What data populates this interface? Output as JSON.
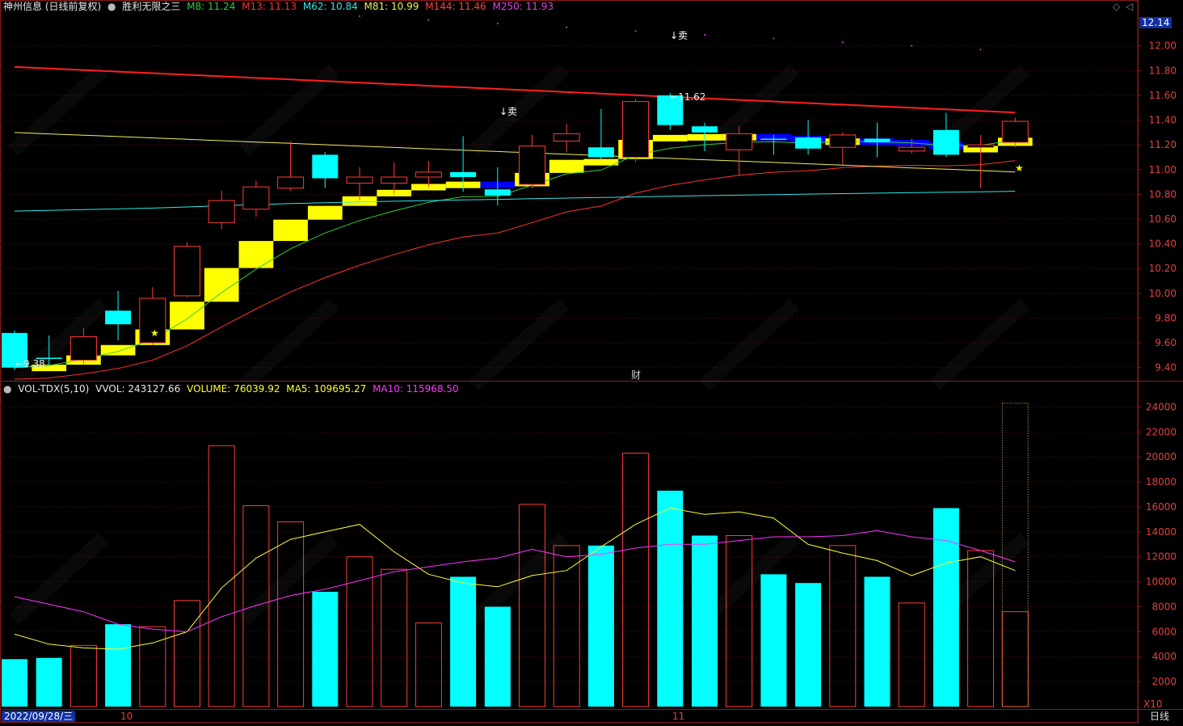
{
  "header": {
    "stock_name": "神州信息 (日线前复权)",
    "indicator_name": "胜利无限之三",
    "ma_labels": [
      {
        "text": "M8: 11.24",
        "color": "#2ecc40"
      },
      {
        "text": "M13: 11.13",
        "color": "#ff3030"
      },
      {
        "text": "M62: 10.84",
        "color": "#2ee6e6"
      },
      {
        "text": "M81: 10.99",
        "color": "#f0f060"
      },
      {
        "text": "M144: 11.46",
        "color": "#ff4040"
      },
      {
        "text": "M250: 11.93",
        "color": "#e040e0"
      }
    ]
  },
  "volume_header": {
    "name": "VOL-TDX(5,10)",
    "vvol": "VVOL: 243127.66",
    "volume": "VOLUME: 76039.92",
    "ma5": "MA5: 109695.27",
    "ma10": "MA10: 115968.50"
  },
  "price_axis": {
    "current_price": "12.14",
    "ticks": [
      "12.00",
      "11.80",
      "11.60",
      "11.40",
      "11.20",
      "11.00",
      "10.80",
      "10.60",
      "10.40",
      "10.20",
      "10.00",
      "9.80",
      "9.60",
      "9.40"
    ]
  },
  "volume_axis": {
    "ticks": [
      "24000",
      "22000",
      "20000",
      "18000",
      "16000",
      "14000",
      "12000",
      "10000",
      "8000",
      "6000",
      "4000",
      "2000"
    ],
    "unit": "X10"
  },
  "annotations": {
    "low_label": "←9.38",
    "high_label": "←11.62",
    "sell_1": "↓卖",
    "sell_2": "↓卖",
    "finance_marker": "财",
    "star": "★"
  },
  "date_axis": {
    "start_date": "2022/09/28/三",
    "month_10": "10",
    "month_11": "11",
    "period": "日线"
  },
  "colors": {
    "up": "#ff3b3b",
    "down": "#00ffff",
    "ma5": "#ffff33",
    "ma10": "#ff33ff",
    "band_up": "#ffff00",
    "band_down": "#0000ff"
  },
  "chart_data": [
    {
      "type": "candlestick",
      "title": "神州信息 (日线前复权)",
      "candles": [
        {
          "o": 9.68,
          "h": 9.7,
          "l": 9.38,
          "c": 9.4
        },
        {
          "o": 9.48,
          "h": 9.66,
          "l": 9.42,
          "c": 9.47
        },
        {
          "o": 9.46,
          "h": 9.72,
          "l": 9.42,
          "c": 9.65
        },
        {
          "o": 9.86,
          "h": 10.02,
          "l": 9.62,
          "c": 9.75
        },
        {
          "o": 9.6,
          "h": 10.05,
          "l": 9.58,
          "c": 9.96
        },
        {
          "o": 9.98,
          "h": 10.41,
          "l": 9.97,
          "c": 10.38
        },
        {
          "o": 10.57,
          "h": 10.83,
          "l": 10.52,
          "c": 10.75
        },
        {
          "o": 10.68,
          "h": 10.91,
          "l": 10.62,
          "c": 10.86
        },
        {
          "o": 10.85,
          "h": 11.23,
          "l": 10.83,
          "c": 10.94
        },
        {
          "o": 11.12,
          "h": 11.14,
          "l": 10.85,
          "c": 10.93
        },
        {
          "o": 10.89,
          "h": 11.02,
          "l": 10.75,
          "c": 10.94
        },
        {
          "o": 10.89,
          "h": 11.06,
          "l": 10.8,
          "c": 10.94
        },
        {
          "o": 10.94,
          "h": 11.07,
          "l": 10.86,
          "c": 10.98
        },
        {
          "o": 10.98,
          "h": 11.27,
          "l": 10.82,
          "c": 10.94
        },
        {
          "o": 10.84,
          "h": 11.02,
          "l": 10.71,
          "c": 10.79
        },
        {
          "o": 10.88,
          "h": 11.28,
          "l": 10.85,
          "c": 11.19
        },
        {
          "o": 11.23,
          "h": 11.37,
          "l": 11.14,
          "c": 11.29
        },
        {
          "o": 11.18,
          "h": 11.49,
          "l": 11.08,
          "c": 11.1
        },
        {
          "o": 11.1,
          "h": 11.57,
          "l": 11.06,
          "c": 11.55
        },
        {
          "o": 11.6,
          "h": 11.62,
          "l": 11.32,
          "c": 11.36
        },
        {
          "o": 11.35,
          "h": 11.38,
          "l": 11.15,
          "c": 11.3
        },
        {
          "o": 11.16,
          "h": 11.35,
          "l": 10.95,
          "c": 11.29
        },
        {
          "o": 11.25,
          "h": 11.28,
          "l": 11.12,
          "c": 11.24
        },
        {
          "o": 11.26,
          "h": 11.4,
          "l": 11.12,
          "c": 11.17
        },
        {
          "o": 11.18,
          "h": 11.3,
          "l": 11.04,
          "c": 11.28
        },
        {
          "o": 11.25,
          "h": 11.38,
          "l": 11.1,
          "c": 11.22
        },
        {
          "o": 11.15,
          "h": 11.25,
          "l": 11.13,
          "c": 11.18
        },
        {
          "o": 11.32,
          "h": 11.46,
          "l": 11.1,
          "c": 11.12
        },
        {
          "o": 11.18,
          "h": 11.28,
          "l": 10.85,
          "c": 11.2
        },
        {
          "o": 11.22,
          "h": 11.42,
          "l": 11.18,
          "c": 11.39
        }
      ],
      "ylim": [
        9.3,
        12.24
      ]
    },
    {
      "type": "bar",
      "title": "VOL-TDX(5,10)",
      "unit": "X10",
      "values": [
        3800,
        3900,
        4900,
        6600,
        6400,
        8500,
        20900,
        16100,
        14800,
        9200,
        12000,
        11000,
        6700,
        10400,
        8000,
        16200,
        12900,
        12900,
        20300,
        17300,
        13700,
        13700,
        10600,
        9900,
        12900,
        10400,
        8300,
        15900,
        12500,
        7600
      ],
      "up": [
        false,
        false,
        true,
        false,
        true,
        true,
        true,
        true,
        true,
        false,
        true,
        true,
        true,
        false,
        false,
        true,
        true,
        false,
        true,
        false,
        false,
        true,
        false,
        false,
        true,
        false,
        true,
        false,
        true,
        true
      ],
      "ma5": [
        5800,
        5000,
        4700,
        4600,
        5100,
        6000,
        9500,
        11900,
        13400,
        14000,
        14600,
        12400,
        10600,
        9900,
        9600,
        10500,
        10900,
        12800,
        14600,
        15900,
        15400,
        15600,
        15100,
        13000,
        12300,
        11700,
        10500,
        11500,
        12000,
        10900
      ],
      "ma10": [
        8800,
        8200,
        7600,
        6600,
        6200,
        6000,
        7200,
        8100,
        8900,
        9400,
        10100,
        10800,
        11200,
        11600,
        11900,
        12600,
        12000,
        12200,
        12700,
        13000,
        13000,
        13300,
        13600,
        13600,
        13700,
        14100,
        13600,
        13300,
        12500,
        11600
      ],
      "ylim": [
        0,
        25000
      ]
    }
  ]
}
